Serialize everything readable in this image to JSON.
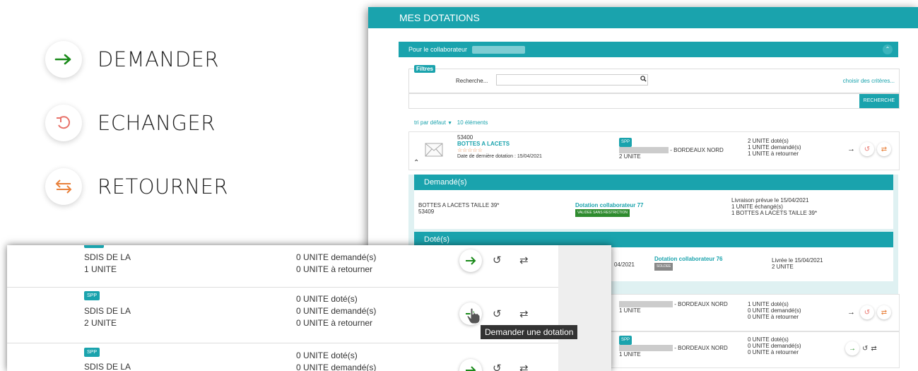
{
  "legend": [
    {
      "label": "DEMANDER",
      "icon": "arrow-right-icon",
      "color": "#1a8a1a"
    },
    {
      "label": "ECHANGER",
      "icon": "undo-icon",
      "color": "#e8736b"
    },
    {
      "label": "RETOURNER",
      "icon": "swap-arrows-icon",
      "color": "#e8803a"
    }
  ],
  "panel": {
    "title": "MES DOTATIONS",
    "collab_label": "Pour le collaborateur",
    "filters": {
      "tag": "Filtres",
      "search_label": "Recherche...",
      "search_value": "",
      "choose_link": "choisir des critères...",
      "search_button": "RECHERCHE"
    },
    "sort": {
      "label": "tri par défaut",
      "count": "10 éléments"
    },
    "item1": {
      "code": "53400",
      "name": "BOTTES A LACETS",
      "stars": "☆☆☆☆☆",
      "last_date": "Date de dernière dotation : 15/04/2021",
      "badge": "SPP",
      "location": "- BORDEAUX NORD",
      "qty": "2 UNITE",
      "stat1": "2 UNITE doté(s)",
      "stat2": "1 UNITE demandé(s)",
      "stat3": "1 UNITE à retourner"
    },
    "demandes": {
      "title": "Demandé(s)",
      "product": "BOTTES A LACETS TAILLE 39*",
      "code": "53409",
      "dotation": "Dotation collaborateur 77",
      "status": "VALIDEE SANS RESTRICTION",
      "info1": "Livraison prévue le 15/04/2021",
      "info2": "1 UNITE échangé(s)",
      "info3": "1 BOTTES A LACETS TAILLE 39*"
    },
    "dotes": {
      "title": "Doté(s)",
      "date_frag": "04/2021",
      "dotation": "Dotation collaborateur 76",
      "status": "SOLDEE",
      "info1": "Livrée le 15/04/2021",
      "info2": "2 UNITE"
    },
    "item2": {
      "badge": "",
      "location": "- BORDEAUX NORD",
      "qty": "1 UNITE",
      "stat1": "1 UNITE doté(s)",
      "stat2": "0 UNITE demandé(s)",
      "stat3": "0 UNITE à retourner"
    },
    "item3": {
      "badge": "SPP",
      "location": "- BORDEAUX NORD",
      "qty": "1 UNITE",
      "stat1": "0 UNITE doté(s)",
      "stat2": "0 UNITE demandé(s)",
      "stat3": "0 UNITE à retourner"
    }
  },
  "zoom": {
    "row1": {
      "line1": "SDIS DE LA",
      "line2": "1 UNITE",
      "stat2": "0 UNITE demandé(s)",
      "stat3": "0 UNITE à retourner"
    },
    "row2": {
      "badge": "SPP",
      "line1": "SDIS DE LA",
      "line2": "2 UNITE",
      "stat1": "0 UNITE doté(s)",
      "stat2": "0 UNITE demandé(s)",
      "stat3": "0 UNITE à retourner"
    },
    "row3": {
      "badge": "SPP",
      "line1": "SDIS DE LA",
      "stat1": "0 UNITE doté(s)",
      "stat2": "0 UNITE demandé(s)"
    },
    "tooltip": "Demander une dotation"
  },
  "colors": {
    "accent": "#1aa3ad",
    "green": "#1a8a1a",
    "red": "#e8736b",
    "orange": "#e8803a"
  }
}
